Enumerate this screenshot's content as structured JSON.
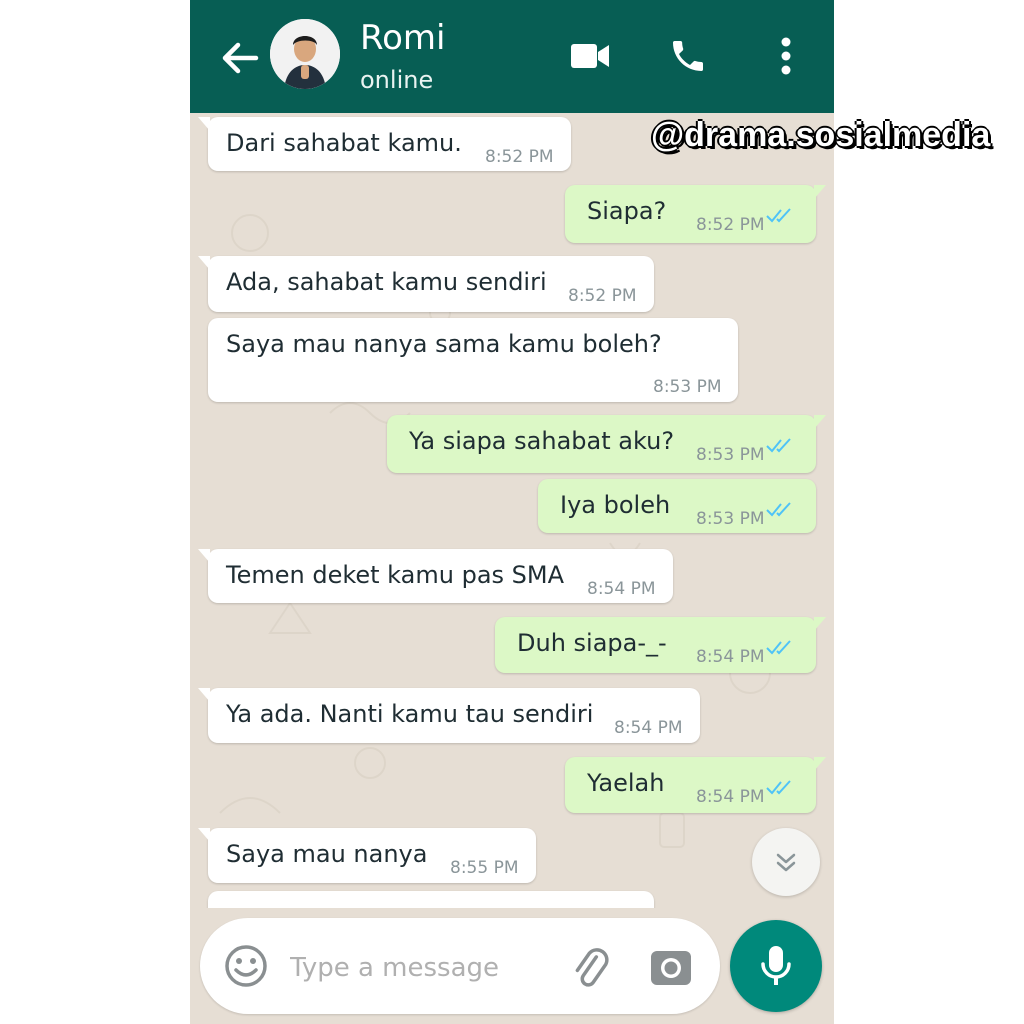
{
  "header": {
    "contact_name": "Romi",
    "status": "online",
    "color": "#075e54"
  },
  "messages": [
    {
      "dir": "in",
      "text": "Dari sahabat kamu.",
      "time": "8:52 PM"
    },
    {
      "dir": "out",
      "text": "Siapa?",
      "time": "8:52 PM",
      "ticks": "read"
    },
    {
      "dir": "in",
      "text": "Ada, sahabat kamu sendiri",
      "time": "8:52 PM"
    },
    {
      "dir": "in",
      "text": "Saya mau nanya sama kamu boleh?",
      "time": "8:53 PM"
    },
    {
      "dir": "out",
      "text": "Ya siapa sahabat aku?",
      "time": "8:53 PM",
      "ticks": "read"
    },
    {
      "dir": "out",
      "text": "Iya boleh",
      "time": "8:53 PM",
      "ticks": "read"
    },
    {
      "dir": "in",
      "text": "Temen deket kamu pas SMA",
      "time": "8:54 PM"
    },
    {
      "dir": "out",
      "text": "Duh siapa-_-",
      "time": "8:54 PM",
      "ticks": "read"
    },
    {
      "dir": "in",
      "text": "Ya ada. Nanti kamu tau sendiri",
      "time": "8:54 PM"
    },
    {
      "dir": "out",
      "text": "Yaelah",
      "time": "8:54 PM",
      "ticks": "read"
    },
    {
      "dir": "in",
      "text": "Saya mau nanya",
      "time": "8:55 PM"
    }
  ],
  "input": {
    "placeholder": "Type a message"
  },
  "icons": {
    "back": "arrow-left-icon",
    "video": "video-camera-icon",
    "call": "phone-icon",
    "menu": "more-vertical-icon",
    "emoji": "emoji-icon",
    "attach": "paperclip-icon",
    "camera": "camera-icon",
    "mic": "microphone-icon",
    "scroll": "double-chevron-down-icon"
  },
  "colors": {
    "outgoing_bubble": "#dcf8c6",
    "incoming_bubble": "#ffffff",
    "read_ticks": "#4fc3f7",
    "mic_button": "#00897b"
  },
  "watermark": "@drama.sosialmedia"
}
